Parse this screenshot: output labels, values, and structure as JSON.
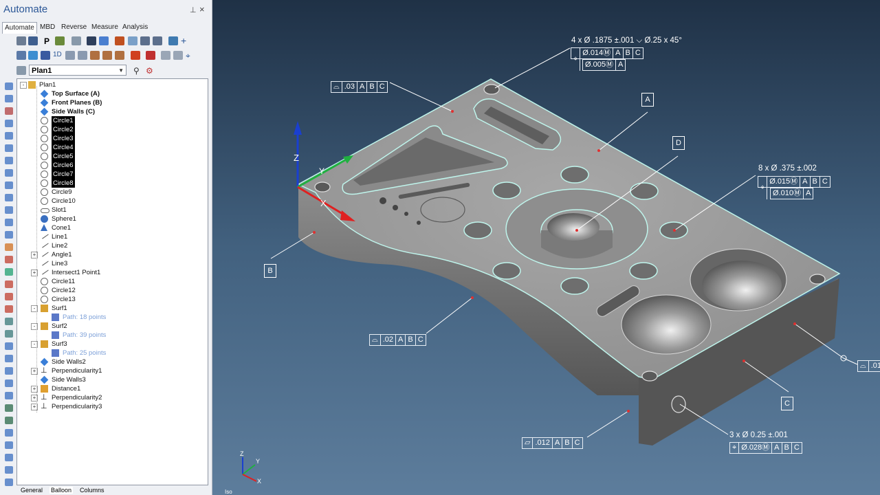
{
  "app": {
    "title": "Automate",
    "pin_label": "ᵖ",
    "close_label": "×"
  },
  "tabs": [
    "Automate",
    "MBD",
    "Reverse",
    "Measure",
    "Analysis"
  ],
  "plan_select": {
    "value": "Plan1"
  },
  "tree": [
    {
      "label": "Plan1",
      "style": "normal",
      "indent": 0,
      "icon": "folder-icon",
      "exp": "-"
    },
    {
      "label": "Top Surface (A)",
      "style": "bold",
      "indent": 2,
      "icon": "datum-plane-icon"
    },
    {
      "label": "Front Planes (B)",
      "style": "bold",
      "indent": 2,
      "icon": "datum-plane-icon"
    },
    {
      "label": "Side Walls (C)",
      "style": "bold",
      "indent": 2,
      "icon": "datum-plane-icon"
    },
    {
      "label": "Circle1",
      "style": "sel",
      "indent": 2,
      "icon": "circle-icon"
    },
    {
      "label": "Circle2",
      "style": "sel",
      "indent": 2,
      "icon": "circle-icon"
    },
    {
      "label": "Circle3",
      "style": "sel",
      "indent": 2,
      "icon": "circle-icon"
    },
    {
      "label": "Circle4",
      "style": "sel",
      "indent": 2,
      "icon": "circle-icon"
    },
    {
      "label": "Circle5",
      "style": "sel",
      "indent": 2,
      "icon": "circle-icon"
    },
    {
      "label": "Circle6",
      "style": "sel",
      "indent": 2,
      "icon": "circle-icon"
    },
    {
      "label": "Circle7",
      "style": "sel",
      "indent": 2,
      "icon": "circle-icon"
    },
    {
      "label": "Circle8",
      "style": "sel",
      "indent": 2,
      "icon": "circle-icon"
    },
    {
      "label": "Circle9",
      "style": "normal",
      "indent": 2,
      "icon": "circle-icon"
    },
    {
      "label": "Circle10",
      "style": "normal",
      "indent": 2,
      "icon": "circle-icon"
    },
    {
      "label": "Slot1",
      "style": "normal",
      "indent": 2,
      "icon": "slot-icon"
    },
    {
      "label": "Sphere1",
      "style": "normal",
      "indent": 2,
      "icon": "sphere-icon"
    },
    {
      "label": "Cone1",
      "style": "normal",
      "indent": 2,
      "icon": "cone-icon"
    },
    {
      "label": "Line1",
      "style": "normal",
      "indent": 2,
      "icon": "line-icon"
    },
    {
      "label": "Line2",
      "style": "normal",
      "indent": 2,
      "icon": "line-icon"
    },
    {
      "label": "Angle1",
      "style": "normal",
      "indent": 2,
      "icon": "angle-icon",
      "exp": "+"
    },
    {
      "label": "Line3",
      "style": "normal",
      "indent": 2,
      "icon": "line-icon"
    },
    {
      "label": "Intersect1 Point1",
      "style": "normal",
      "indent": 2,
      "icon": "intersect-icon",
      "exp": "+"
    },
    {
      "label": "Circle11",
      "style": "normal",
      "indent": 2,
      "icon": "circle-icon"
    },
    {
      "label": "Circle12",
      "style": "normal",
      "indent": 2,
      "icon": "circle-icon"
    },
    {
      "label": "Circle13",
      "style": "normal",
      "indent": 2,
      "icon": "circle-icon"
    },
    {
      "label": "Surf1",
      "style": "normal",
      "indent": 2,
      "icon": "surface-icon",
      "exp": "-"
    },
    {
      "label": "Path: 18 points",
      "style": "path",
      "indent": 3,
      "icon": "path-icon"
    },
    {
      "label": "Surf2",
      "style": "normal",
      "indent": 2,
      "icon": "surface-icon",
      "exp": "-"
    },
    {
      "label": "Path: 39 points",
      "style": "path",
      "indent": 3,
      "icon": "path-icon"
    },
    {
      "label": "Surf3",
      "style": "normal",
      "indent": 2,
      "icon": "surface-icon",
      "exp": "-"
    },
    {
      "label": "Path: 25 points",
      "style": "path",
      "indent": 3,
      "icon": "path-icon"
    },
    {
      "label": "Side Walls2",
      "style": "normal",
      "indent": 2,
      "icon": "datum-plane-icon"
    },
    {
      "label": "Perpendicularity1",
      "style": "normal",
      "indent": 2,
      "icon": "perpendicularity-icon",
      "exp": "+"
    },
    {
      "label": "Side Walls3",
      "style": "normal",
      "indent": 2,
      "icon": "datum-plane-icon"
    },
    {
      "label": "Distance1",
      "style": "normal",
      "indent": 2,
      "icon": "distance-icon",
      "exp": "+"
    },
    {
      "label": "Perpendicularity2",
      "style": "normal",
      "indent": 2,
      "icon": "perpendicularity-icon",
      "exp": "+"
    },
    {
      "label": "Perpendicularity3",
      "style": "normal",
      "indent": 2,
      "icon": "perpendicularity-icon",
      "exp": "+"
    }
  ],
  "bottom_tabs": [
    "General",
    "Balloon",
    "Columns"
  ],
  "viewport": {
    "axis_labels": {
      "z": "Z",
      "y": "Y",
      "x": "X"
    },
    "view_name": "Iso",
    "callouts": {
      "holes_4": {
        "dim": "4 x Ø .1875 ±.001 ⌵ Ø.25 x 45°",
        "fcf1": [
          "⌖",
          "Ø.014Ⓜ",
          "A",
          "B",
          "C"
        ],
        "fcf2": [
          "Ø.005Ⓜ",
          "A"
        ]
      },
      "profile_top": [
        "⌓",
        ".03",
        "A",
        "B",
        "C"
      ],
      "holes_8": {
        "dim": "8 x Ø .375 ±.002",
        "fcf1": [
          "⌖",
          "Ø.015Ⓜ",
          "A",
          "B",
          "C"
        ],
        "fcf2": [
          "Ø.010Ⓜ",
          "A"
        ]
      },
      "profile_side": [
        "⌓",
        ".02",
        "A",
        "B",
        "C"
      ],
      "flatness": [
        "▱",
        ".012",
        "A",
        "B",
        "C"
      ],
      "holes_3": {
        "dim": "3 x Ø 0.25 ±.001",
        "fcf": [
          "⌖",
          "Ø.028Ⓜ",
          "A",
          "B",
          "C"
        ]
      },
      "edge_fcf": [
        "⌓",
        ".01"
      ],
      "datums": [
        "A",
        "B",
        "C",
        "D"
      ]
    }
  },
  "colors": {
    "accent": "#2b5797",
    "selection": "#000000",
    "path_text": "#7da0d8",
    "edge_highlight": "#bff5ec"
  }
}
